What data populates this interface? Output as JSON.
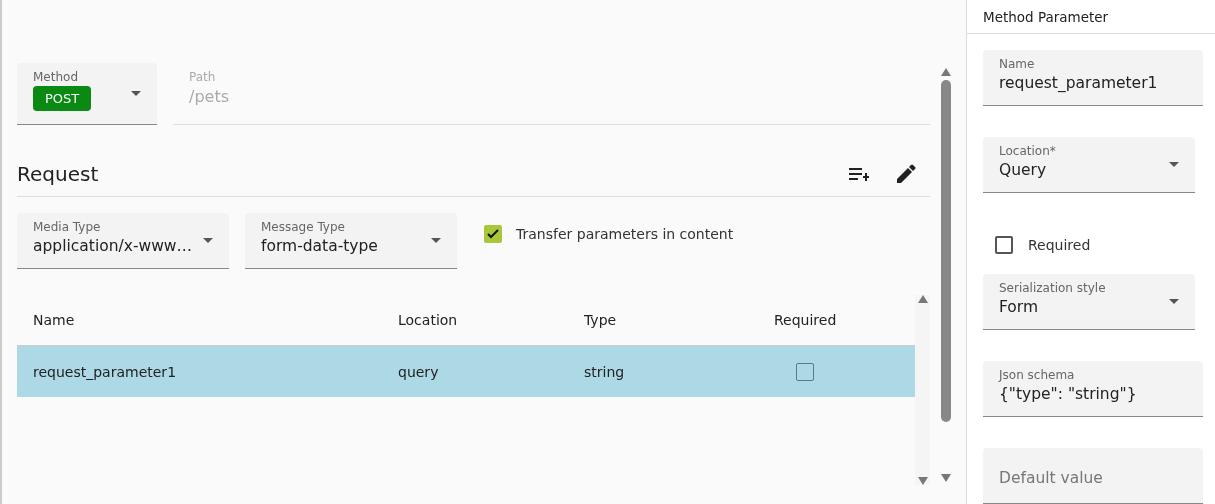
{
  "method_field": {
    "label": "Method",
    "value": "POST"
  },
  "path_field": {
    "label": "Path",
    "value": "/pets",
    "disabled": true
  },
  "request": {
    "title": "Request",
    "media_type": {
      "label": "Media Type",
      "value": "application/x-www…"
    },
    "message_type": {
      "label": "Message Type",
      "value": "form-data-type"
    },
    "transfer_checkbox": {
      "label": "Transfer parameters in content",
      "checked": true
    }
  },
  "table": {
    "columns": [
      "Name",
      "Location",
      "Type",
      "Required"
    ],
    "rows": [
      {
        "name": "request_parameter1",
        "location": "query",
        "type": "string",
        "required": false,
        "selected": true
      }
    ]
  },
  "panel": {
    "title": "Method Parameter",
    "fields": [
      {
        "kind": "text",
        "label": "Name",
        "value": "request_parameter1"
      },
      {
        "kind": "select",
        "label": "Location*",
        "value": "Query"
      },
      {
        "kind": "checkbox",
        "label": "Required",
        "checked": false
      },
      {
        "kind": "select",
        "label": "Serialization style",
        "value": "Form"
      },
      {
        "kind": "text",
        "label": "Json schema",
        "value": "{\"type\": \"string\"}"
      },
      {
        "kind": "text",
        "placeholder": "Default value"
      }
    ]
  }
}
